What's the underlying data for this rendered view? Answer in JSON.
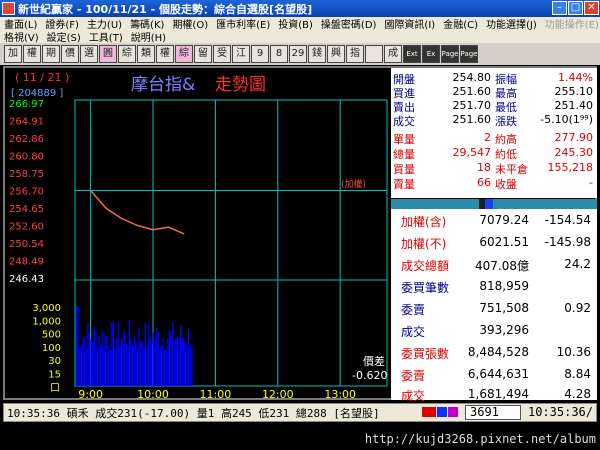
{
  "window": {
    "title": "新世紀贏家 - 100/11/21 - 個股走勢：綜合自選股[名望股]"
  },
  "menu1": [
    "畫面(L)",
    "證券(F)",
    "主力(U)",
    "籌碼(K)",
    "期權(O)",
    "匯市利率(E)",
    "投資(B)",
    "操盤密碼(D)",
    "國際資訊(I)",
    "金融(C)",
    "功能選擇(J)",
    "功能操作(E)"
  ],
  "menu2": [
    "格視(V)",
    "設定(S)",
    "工具(T)",
    "說明(H)"
  ],
  "toolbar": [
    "加",
    "權",
    "期",
    "價",
    "選",
    "圓",
    "綜",
    "類",
    "權",
    "綜",
    "留",
    "受",
    "江",
    "9",
    "8",
    "29",
    "錢",
    "興",
    "指",
    "",
    "成",
    "Ext",
    "Ex",
    "Page",
    "Page"
  ],
  "chart": {
    "date": "( 11 / 21 )",
    "volume_label": "[ 204889 ]",
    "title_part1": "摩台指&",
    "title_part2": "走勢圖",
    "index_label": "(加權)",
    "price_ticks": [
      "266.97",
      "264.91",
      "262.86",
      "260.80",
      "258.75",
      "256.70",
      "254.65",
      "252.60",
      "250.54",
      "248.49",
      "246.43"
    ],
    "volume_ticks": [
      "3,000",
      "1,000",
      "500",
      "100",
      "30",
      "15",
      "口"
    ],
    "time_ticks": [
      "9:00",
      "10:00",
      "11:00",
      "12:00",
      "13:00"
    ],
    "diff_label": "價差",
    "diff_value": "-0.620"
  },
  "chart_data": {
    "type": "line",
    "title": "摩台指& 走勢圖",
    "ylim": [
      246.43,
      266.97
    ],
    "reference_price": 256.7,
    "x": [
      "9:00",
      "9:15",
      "9:30",
      "9:45",
      "10:00",
      "10:15",
      "10:30"
    ],
    "series": [
      {
        "values": [
          256.7,
          254.6,
          253.4,
          252.6,
          252.1,
          252.4,
          251.6
        ]
      }
    ]
  },
  "quote": {
    "rows": [
      {
        "l1": "開盤",
        "v1": "254.80",
        "l2": "振幅",
        "v2": "1.44%"
      },
      {
        "l1": "買進",
        "v1": "251.60",
        "l2": "最高",
        "v2": "255.10"
      },
      {
        "l1": "賣出",
        "v1": "251.70",
        "l2": "最低",
        "v2": "251.40"
      },
      {
        "l1": "成交",
        "v1": "251.60",
        "l2": "漲跌",
        "v2": "-5.10(1⁹⁹)"
      },
      {
        "l1": "單量",
        "v1": "2",
        "l2": "約高",
        "v2": "277.90"
      },
      {
        "l1": "總量",
        "v1": "29,547",
        "l2": "約低",
        "v2": "245.30"
      },
      {
        "l1": "買量",
        "v1": "18",
        "l2": "未平倉",
        "v2": "155,218"
      },
      {
        "l1": "賣量",
        "v1": "66",
        "l2": "收盤",
        "v2": "-"
      }
    ]
  },
  "index_panel": {
    "rows": [
      {
        "label": "加權(含)",
        "value": "7079.24",
        "change": "-154.54",
        "red": true
      },
      {
        "label": "加權(不)",
        "value": "6021.51",
        "change": "-145.98",
        "red": true
      },
      {
        "label": "成交總額",
        "value": "407.08億",
        "change": "24.2",
        "red": true
      },
      {
        "label": "委買筆數",
        "value": "818,959",
        "change": "",
        "red": false
      },
      {
        "label": "委賣",
        "value": "751,508",
        "change": "0.92",
        "red": false
      },
      {
        "label": "成交",
        "value": "393,296",
        "change": "",
        "red": false
      },
      {
        "label": "委買張數",
        "value": "8,484,528",
        "change": "10.36",
        "red": true
      },
      {
        "label": "委賣",
        "value": "6,644,631",
        "change": "8.84",
        "red": true
      },
      {
        "label": "成交",
        "value": "1,681,494",
        "change": "4.28",
        "red": true
      }
    ]
  },
  "status": {
    "text": "10:35:36 碩禾 成交231(-17.00) 量1 高245 低231 總288 [名望股]",
    "code": "3691",
    "time": "10:35:36/"
  },
  "footer": {
    "url": "http://kujd3268.pixnet.net/album"
  },
  "colors": {
    "grid": "#00c0c0",
    "price_line": "#ff6060",
    "volume": "#0000ff",
    "tick_red": "#ff4040",
    "tick_green": "#00ff00"
  }
}
